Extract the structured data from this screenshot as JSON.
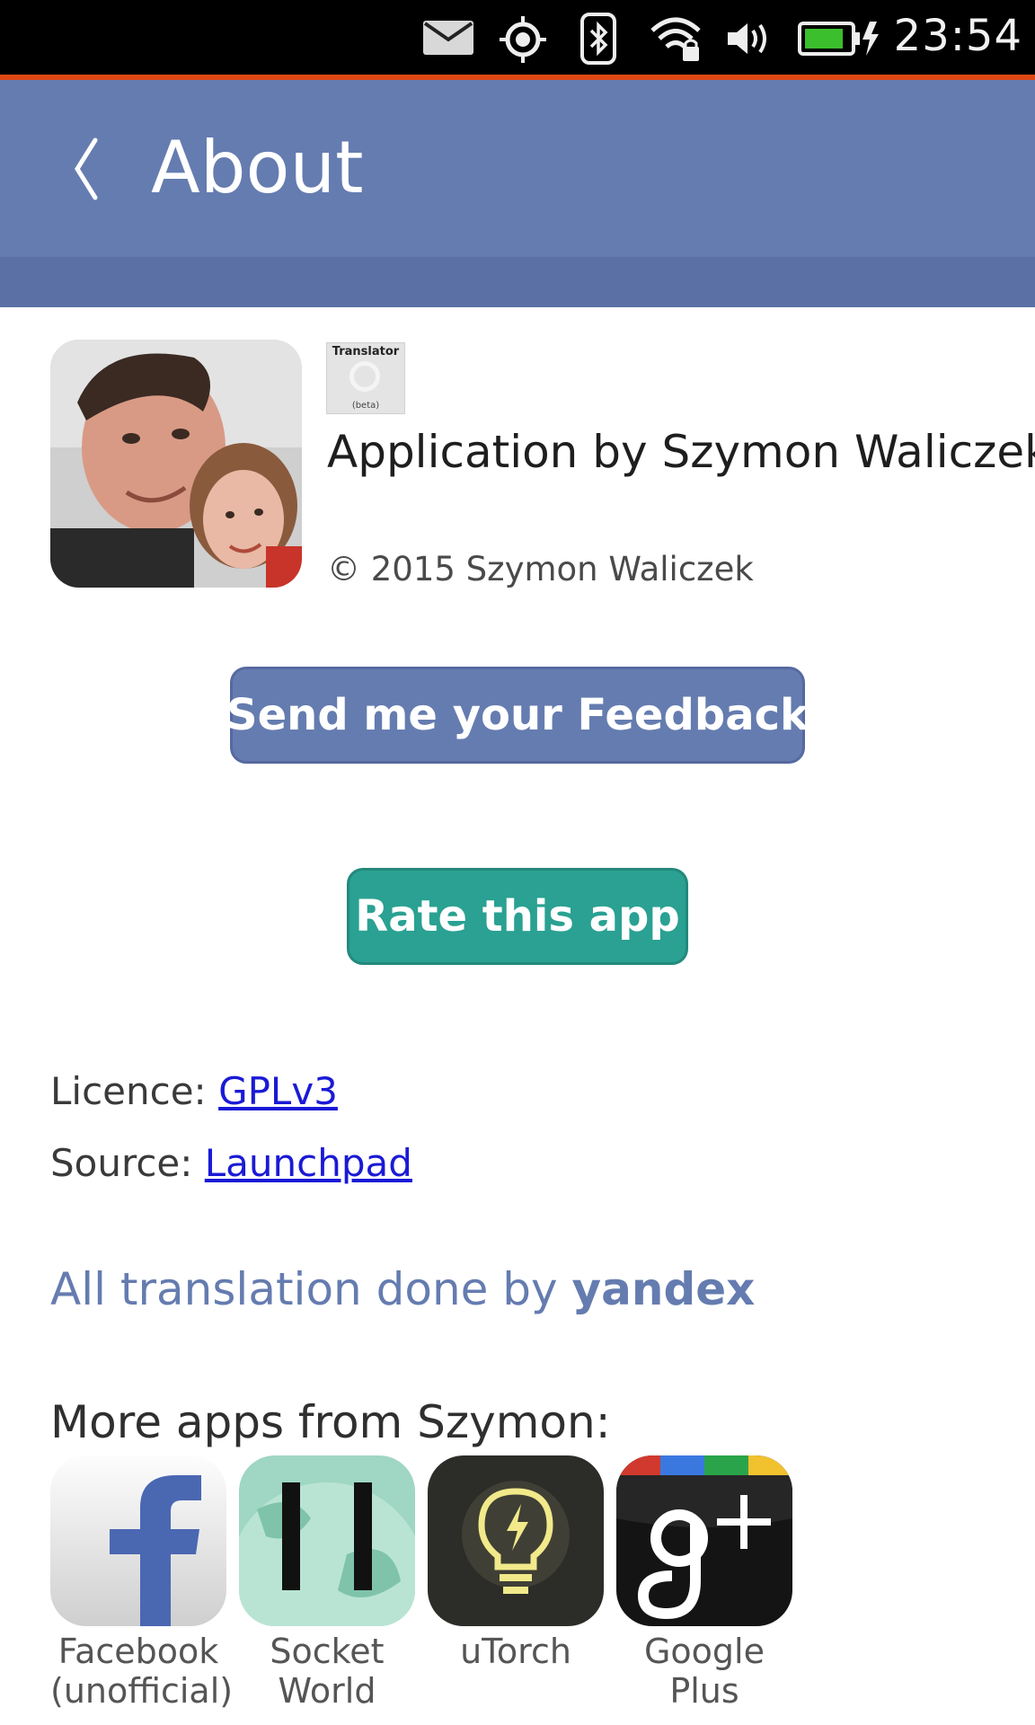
{
  "status_bar": {
    "time": "23:54",
    "icons": [
      "mail-icon",
      "location-icon",
      "bluetooth-icon",
      "wifi-locked-icon",
      "volume-icon",
      "battery-charging-icon"
    ]
  },
  "header": {
    "title": "About"
  },
  "author": {
    "app_thumb_title": "Translator",
    "app_thumb_subtitle": "(beta)",
    "application_by": "Application by Szymon Waliczek",
    "copyright": "© 2015 Szymon Waliczek"
  },
  "buttons": {
    "feedback": "Send me your Feedback",
    "rate": "Rate this app"
  },
  "info": {
    "licence_label": "Licence: ",
    "licence_link": "GPLv3",
    "source_label": "Source: ",
    "source_link": "Launchpad"
  },
  "translation": {
    "prefix": "All translation done by ",
    "provider": "yandex"
  },
  "more_apps": {
    "title": "More apps from Szymon:",
    "apps": [
      {
        "line1": "Facebook",
        "line2": "(unofficial)"
      },
      {
        "line1": "Socket",
        "line2": "World"
      },
      {
        "line1": "uTorch",
        "line2": ""
      },
      {
        "line1": "Google",
        "line2": "Plus"
      }
    ]
  },
  "colors": {
    "header": "#657cb0",
    "accent_orange": "#dd4814",
    "rate_button": "#2aa192",
    "link": "#1a1ad6"
  }
}
